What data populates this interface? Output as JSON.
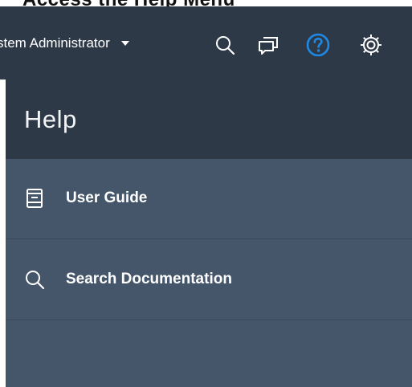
{
  "page": {
    "heading": "Access the Help Menu"
  },
  "topbar": {
    "user_name": "stem Administrator",
    "icons": {
      "search": "search-icon",
      "chat": "chat-icon",
      "help": "help-icon",
      "settings": "gear-icon"
    },
    "help_active_color": "#1e88e5"
  },
  "help_panel": {
    "title": "Help",
    "items": [
      {
        "label": "User Guide",
        "icon": "book-icon"
      },
      {
        "label": "Search Documentation",
        "icon": "search-icon"
      }
    ]
  },
  "colors": {
    "topbar_bg": "#2e3947",
    "panel_bg": "#45566a",
    "text": "#ffffff"
  }
}
